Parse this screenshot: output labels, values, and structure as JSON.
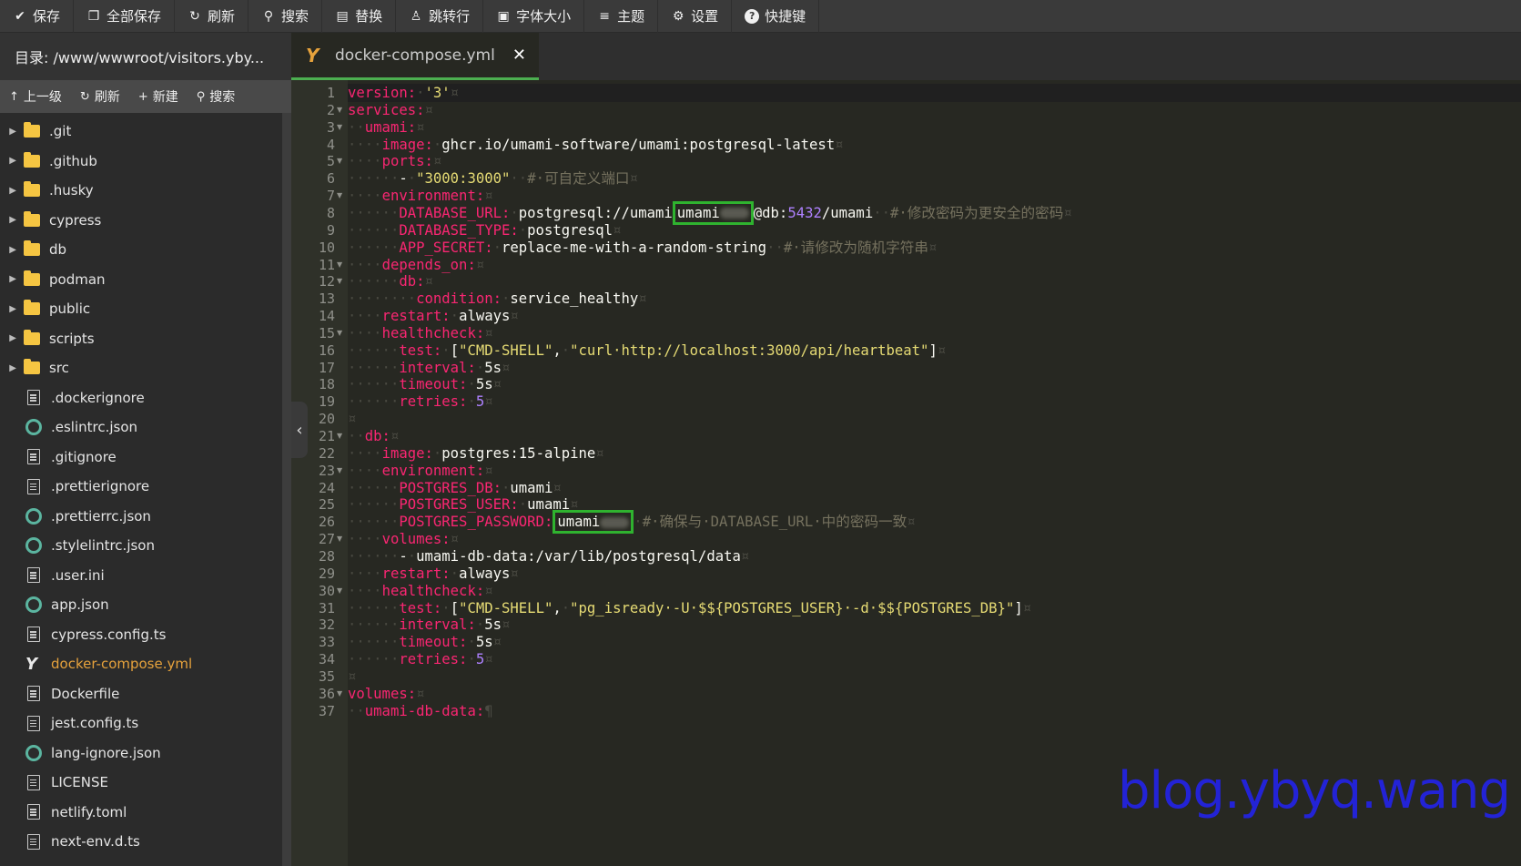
{
  "toolbar": {
    "items": [
      {
        "icon": "check-icon",
        "label": "保存"
      },
      {
        "icon": "copy-icon",
        "label": "全部保存"
      },
      {
        "icon": "refresh-icon",
        "label": "刷新"
      },
      {
        "icon": "search-icon",
        "label": "搜索"
      },
      {
        "icon": "replace-icon",
        "label": "替换"
      },
      {
        "icon": "user-icon",
        "label": "跳转行"
      },
      {
        "icon": "font-size-icon",
        "label": "字体大小"
      },
      {
        "icon": "menu-icon",
        "label": "主题"
      },
      {
        "icon": "gear-icon",
        "label": "设置"
      },
      {
        "icon": "help-icon",
        "label": "快捷键"
      }
    ]
  },
  "sidebar": {
    "dir_label": "目录: /www/wwwroot/visitors.yby...",
    "actions": [
      {
        "icon": "arrow-up-icon",
        "label": "上一级"
      },
      {
        "icon": "refresh-icon",
        "label": "刷新"
      },
      {
        "icon": "plus-icon",
        "label": "新建"
      },
      {
        "icon": "search-icon",
        "label": "搜索"
      }
    ],
    "tree": [
      {
        "type": "folder",
        "name": ".git"
      },
      {
        "type": "folder",
        "name": ".github"
      },
      {
        "type": "folder",
        "name": ".husky"
      },
      {
        "type": "folder",
        "name": "cypress"
      },
      {
        "type": "folder",
        "name": "db"
      },
      {
        "type": "folder",
        "name": "podman"
      },
      {
        "type": "folder",
        "name": "public"
      },
      {
        "type": "folder",
        "name": "scripts"
      },
      {
        "type": "folder",
        "name": "src"
      },
      {
        "type": "file",
        "name": ".dockerignore"
      },
      {
        "type": "json",
        "name": ".eslintrc.json"
      },
      {
        "type": "file",
        "name": ".gitignore"
      },
      {
        "type": "file",
        "name": ".prettierignore"
      },
      {
        "type": "json",
        "name": ".prettierrc.json"
      },
      {
        "type": "json",
        "name": ".stylelintrc.json"
      },
      {
        "type": "file",
        "name": ".user.ini"
      },
      {
        "type": "json",
        "name": "app.json"
      },
      {
        "type": "file",
        "name": "cypress.config.ts"
      },
      {
        "type": "yml",
        "name": "docker-compose.yml",
        "active": true
      },
      {
        "type": "file",
        "name": "Dockerfile"
      },
      {
        "type": "file",
        "name": "jest.config.ts"
      },
      {
        "type": "json",
        "name": "lang-ignore.json"
      },
      {
        "type": "file",
        "name": "LICENSE"
      },
      {
        "type": "file",
        "name": "netlify.toml"
      },
      {
        "type": "file",
        "name": "next-env.d.ts"
      }
    ]
  },
  "tab": {
    "label": "docker-compose.yml",
    "close": "✕"
  },
  "editor": {
    "lines": [
      [
        [
          "k",
          "version:"
        ],
        [
          "ws",
          "·"
        ],
        [
          "s",
          "'3'"
        ],
        [
          "ws",
          "¤"
        ]
      ],
      [
        [
          "k",
          "services:"
        ],
        [
          "ws",
          "¤"
        ]
      ],
      [
        [
          "ws",
          "··"
        ],
        [
          "k",
          "umami:"
        ],
        [
          "ws",
          "¤"
        ]
      ],
      [
        [
          "ws",
          "····"
        ],
        [
          "k",
          "image:"
        ],
        [
          "ws",
          "·"
        ],
        [
          "v",
          "ghcr.io/umami-software/umami:postgresql-latest"
        ],
        [
          "ws",
          "¤"
        ]
      ],
      [
        [
          "ws",
          "····"
        ],
        [
          "k",
          "ports:"
        ],
        [
          "ws",
          "¤"
        ]
      ],
      [
        [
          "ws",
          "······"
        ],
        [
          "v",
          "-"
        ],
        [
          "ws",
          "·"
        ],
        [
          "s",
          "\"3000:3000\""
        ],
        [
          "ws",
          "··"
        ],
        [
          "c",
          "#·可自定义端口"
        ],
        [
          "ws",
          "¤"
        ]
      ],
      [
        [
          "ws",
          "····"
        ],
        [
          "k",
          "environment:"
        ],
        [
          "ws",
          "¤"
        ]
      ],
      [
        [
          "ws",
          "······"
        ],
        [
          "k",
          "DATABASE_URL:"
        ],
        [
          "ws",
          "·"
        ],
        [
          "v",
          "postgresql://umami"
        ],
        [
          "box",
          "umami"
        ],
        [
          "v",
          "@db:"
        ],
        [
          "n",
          "5432"
        ],
        [
          "v",
          "/umami"
        ],
        [
          "ws",
          "··"
        ],
        [
          "c",
          "#·修改密码为更安全的密码"
        ],
        [
          "ws",
          "¤"
        ]
      ],
      [
        [
          "ws",
          "······"
        ],
        [
          "k",
          "DATABASE_TYPE:"
        ],
        [
          "ws",
          "·"
        ],
        [
          "v",
          "postgresql"
        ],
        [
          "ws",
          "¤"
        ]
      ],
      [
        [
          "ws",
          "······"
        ],
        [
          "k",
          "APP_SECRET:"
        ],
        [
          "ws",
          "·"
        ],
        [
          "v",
          "replace-me-with-a-random-string"
        ],
        [
          "ws",
          "··"
        ],
        [
          "c",
          "#·请修改为随机字符串"
        ],
        [
          "ws",
          "¤"
        ]
      ],
      [
        [
          "ws",
          "····"
        ],
        [
          "k",
          "depends_on:"
        ],
        [
          "ws",
          "¤"
        ]
      ],
      [
        [
          "ws",
          "······"
        ],
        [
          "k",
          "db:"
        ],
        [
          "ws",
          "¤"
        ]
      ],
      [
        [
          "ws",
          "········"
        ],
        [
          "k",
          "condition:"
        ],
        [
          "ws",
          "·"
        ],
        [
          "v",
          "service_healthy"
        ],
        [
          "ws",
          "¤"
        ]
      ],
      [
        [
          "ws",
          "····"
        ],
        [
          "k",
          "restart:"
        ],
        [
          "ws",
          "·"
        ],
        [
          "v",
          "always"
        ],
        [
          "ws",
          "¤"
        ]
      ],
      [
        [
          "ws",
          "····"
        ],
        [
          "k",
          "healthcheck:"
        ],
        [
          "ws",
          "¤"
        ]
      ],
      [
        [
          "ws",
          "······"
        ],
        [
          "k",
          "test:"
        ],
        [
          "ws",
          "·"
        ],
        [
          "v",
          "["
        ],
        [
          "s",
          "\"CMD-SHELL\""
        ],
        [
          "v",
          ","
        ],
        [
          "ws",
          "·"
        ],
        [
          "s",
          "\"curl·http://localhost:3000/api/heartbeat\""
        ],
        [
          "v",
          "]"
        ],
        [
          "ws",
          "¤"
        ]
      ],
      [
        [
          "ws",
          "······"
        ],
        [
          "k",
          "interval:"
        ],
        [
          "ws",
          "·"
        ],
        [
          "v",
          "5s"
        ],
        [
          "ws",
          "¤"
        ]
      ],
      [
        [
          "ws",
          "······"
        ],
        [
          "k",
          "timeout:"
        ],
        [
          "ws",
          "·"
        ],
        [
          "v",
          "5s"
        ],
        [
          "ws",
          "¤"
        ]
      ],
      [
        [
          "ws",
          "······"
        ],
        [
          "k",
          "retries:"
        ],
        [
          "ws",
          "·"
        ],
        [
          "n",
          "5"
        ],
        [
          "ws",
          "¤"
        ]
      ],
      [
        [
          "ws",
          "¤"
        ]
      ],
      [
        [
          "ws",
          "··"
        ],
        [
          "k",
          "db:"
        ],
        [
          "ws",
          "¤"
        ]
      ],
      [
        [
          "ws",
          "····"
        ],
        [
          "k",
          "image:"
        ],
        [
          "ws",
          "·"
        ],
        [
          "v",
          "postgres:15-alpine"
        ],
        [
          "ws",
          "¤"
        ]
      ],
      [
        [
          "ws",
          "····"
        ],
        [
          "k",
          "environment:"
        ],
        [
          "ws",
          "¤"
        ]
      ],
      [
        [
          "ws",
          "······"
        ],
        [
          "k",
          "POSTGRES_DB:"
        ],
        [
          "ws",
          "·"
        ],
        [
          "v",
          "umami"
        ],
        [
          "ws",
          "¤"
        ]
      ],
      [
        [
          "ws",
          "······"
        ],
        [
          "k",
          "POSTGRES_USER:"
        ],
        [
          "ws",
          "·"
        ],
        [
          "v",
          "umami"
        ],
        [
          "ws",
          "¤"
        ]
      ],
      [
        [
          "ws",
          "······"
        ],
        [
          "k",
          "POSTGRES_PASSWORD:"
        ],
        [
          "box",
          "umami"
        ],
        [
          "ws",
          "·"
        ],
        [
          "c",
          "#·确保与·DATABASE_URL·中的密码一致"
        ],
        [
          "ws",
          "¤"
        ]
      ],
      [
        [
          "ws",
          "····"
        ],
        [
          "k",
          "volumes:"
        ],
        [
          "ws",
          "¤"
        ]
      ],
      [
        [
          "ws",
          "······"
        ],
        [
          "v",
          "-"
        ],
        [
          "ws",
          "·"
        ],
        [
          "v",
          "umami-db-data:/var/lib/postgresql/data"
        ],
        [
          "ws",
          "¤"
        ]
      ],
      [
        [
          "ws",
          "····"
        ],
        [
          "k",
          "restart:"
        ],
        [
          "ws",
          "·"
        ],
        [
          "v",
          "always"
        ],
        [
          "ws",
          "¤"
        ]
      ],
      [
        [
          "ws",
          "····"
        ],
        [
          "k",
          "healthcheck:"
        ],
        [
          "ws",
          "¤"
        ]
      ],
      [
        [
          "ws",
          "······"
        ],
        [
          "k",
          "test:"
        ],
        [
          "ws",
          "·"
        ],
        [
          "v",
          "["
        ],
        [
          "s",
          "\"CMD-SHELL\""
        ],
        [
          "v",
          ","
        ],
        [
          "ws",
          "·"
        ],
        [
          "s",
          "\"pg_isready·-U·$${POSTGRES_USER}·-d·$${POSTGRES_DB}\""
        ],
        [
          "v",
          "]"
        ],
        [
          "ws",
          "¤"
        ]
      ],
      [
        [
          "ws",
          "······"
        ],
        [
          "k",
          "interval:"
        ],
        [
          "ws",
          "·"
        ],
        [
          "v",
          "5s"
        ],
        [
          "ws",
          "¤"
        ]
      ],
      [
        [
          "ws",
          "······"
        ],
        [
          "k",
          "timeout:"
        ],
        [
          "ws",
          "·"
        ],
        [
          "v",
          "5s"
        ],
        [
          "ws",
          "¤"
        ]
      ],
      [
        [
          "ws",
          "······"
        ],
        [
          "k",
          "retries:"
        ],
        [
          "ws",
          "·"
        ],
        [
          "n",
          "5"
        ],
        [
          "ws",
          "¤"
        ]
      ],
      [
        [
          "ws",
          "¤"
        ]
      ],
      [
        [
          "k",
          "volumes:"
        ],
        [
          "ws",
          "¤"
        ]
      ],
      [
        [
          "ws",
          "··"
        ],
        [
          "k",
          "umami-db-data:"
        ],
        [
          "ws",
          "¶"
        ]
      ]
    ],
    "fold_lines": [
      2,
      3,
      5,
      7,
      11,
      12,
      15,
      21,
      23,
      27,
      30,
      36
    ]
  },
  "watermark": "blog.ybyq.wang"
}
